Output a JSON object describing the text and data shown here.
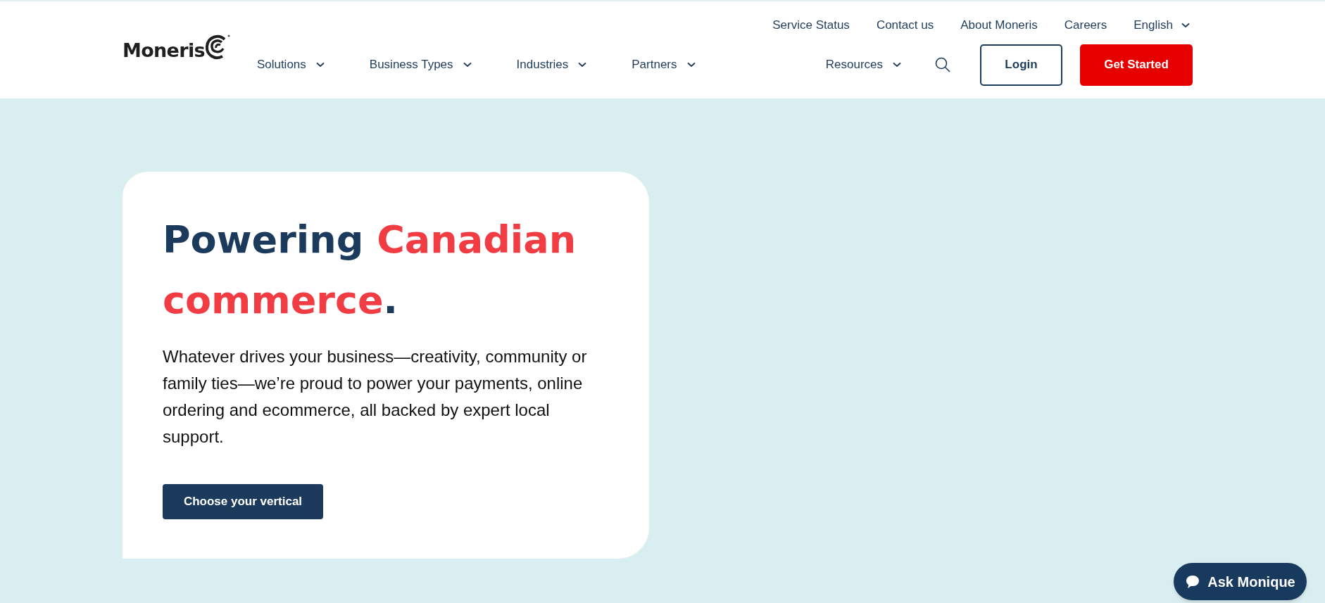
{
  "header": {
    "logo": "Moneris",
    "utility_links": [
      "Service Status",
      "Contact us",
      "About Moneris",
      "Careers"
    ],
    "language": {
      "label": "English",
      "expanded": false
    },
    "nav": [
      {
        "label": "Solutions",
        "expanded": false
      },
      {
        "label": "Business Types",
        "expanded": false
      },
      {
        "label": "Industries",
        "expanded": false
      },
      {
        "label": "Partners",
        "expanded": false
      },
      {
        "label": "Resources",
        "expanded": false
      }
    ],
    "login": "Login",
    "get_started": "Get Started"
  },
  "hero": {
    "heading": {
      "lead": "Powering ",
      "highlight": "Canadian commerce",
      "end": "."
    },
    "body": "Whatever drives your business—creativity, community or family ties—we’re proud to power your payments, online ordering and ecommerce, all backed by expert local support.",
    "button": "Choose your vertical"
  },
  "chat": {
    "label": "Ask Monique"
  }
}
